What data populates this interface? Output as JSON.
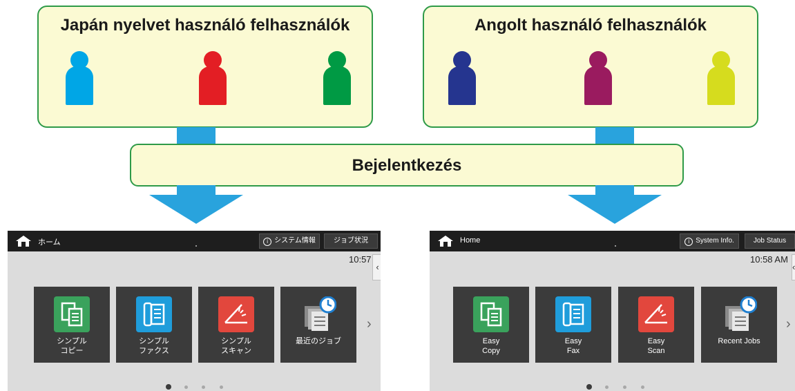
{
  "japanese_group": {
    "title": "Japán nyelvet használó felhasználók"
  },
  "english_group": {
    "title": "Angolt használó felhasználók"
  },
  "login": {
    "label": "Bejelentkezés"
  },
  "user_colors": {
    "japanese": [
      "#00a6e6",
      "#e31e24",
      "#009a44"
    ],
    "english": [
      "#25358f",
      "#9a1b5f",
      "#d6dc1e"
    ]
  },
  "screen_jp": {
    "home_label": "ホーム",
    "system_info": "システム情報",
    "job_status": "ジョブ状況",
    "time": "10:57",
    "side_tab": "‹",
    "next": "›",
    "tiles": [
      {
        "line1": "シンプル",
        "line2": "コピー",
        "icon": "copy-icon",
        "color": "#3aa25c"
      },
      {
        "line1": "シンプル",
        "line2": "ファクス",
        "icon": "fax-icon",
        "color": "#1f9ddb"
      },
      {
        "line1": "シンプル",
        "line2": "スキャン",
        "icon": "scan-icon",
        "color": "#e2473d"
      },
      {
        "line1": "最近のジョブ",
        "line2": "",
        "icon": "recent-jobs-icon",
        "color": "#cfcfcf"
      }
    ]
  },
  "screen_en": {
    "home_label": "Home",
    "system_info": "System Info.",
    "job_status": "Job Status",
    "time": "10:58 AM",
    "side_tab": "‹",
    "next": "›",
    "tiles": [
      {
        "line1": "Easy",
        "line2": "Copy",
        "icon": "copy-icon",
        "color": "#3aa25c"
      },
      {
        "line1": "Easy",
        "line2": "Fax",
        "icon": "fax-icon",
        "color": "#1f9ddb"
      },
      {
        "line1": "Easy",
        "line2": "Scan",
        "icon": "scan-icon",
        "color": "#e2473d"
      },
      {
        "line1": "Recent Jobs",
        "line2": "",
        "icon": "recent-jobs-icon",
        "color": "#cfcfcf"
      }
    ]
  },
  "page_indicator": {
    "count": 4,
    "active": 1
  }
}
